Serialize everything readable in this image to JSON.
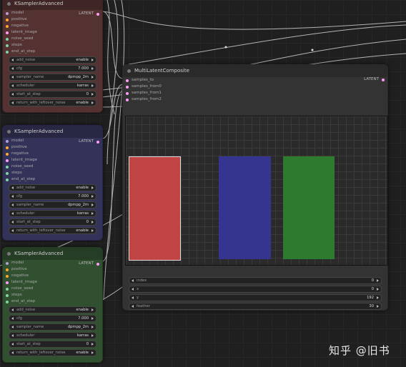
{
  "nodes": {
    "red": {
      "title": "KSamplerAdvanced",
      "inputs": [
        "model",
        "positive",
        "negative",
        "latent_image",
        "noise_seed",
        "steps",
        "end_at_step"
      ],
      "output": "LATENT",
      "widgets": [
        {
          "label": "add_noise",
          "value": "enable"
        },
        {
          "label": "cfg",
          "value": "7.000"
        },
        {
          "label": "sampler_name",
          "value": "dpmpp_2m"
        },
        {
          "label": "scheduler",
          "value": "karras"
        },
        {
          "label": "start_at_step",
          "value": "0"
        },
        {
          "label": "return_with_leftover_noise",
          "value": "enable"
        }
      ]
    },
    "blue": {
      "title": "KSamplerAdvanced",
      "inputs": [
        "model",
        "positive",
        "negative",
        "latent_image",
        "noise_seed",
        "steps",
        "end_at_step"
      ],
      "output": "LATENT",
      "widgets": [
        {
          "label": "add_noise",
          "value": "enable"
        },
        {
          "label": "cfg",
          "value": "7.000"
        },
        {
          "label": "sampler_name",
          "value": "dpmpp_2m"
        },
        {
          "label": "scheduler",
          "value": "karras"
        },
        {
          "label": "start_at_step",
          "value": "0"
        },
        {
          "label": "return_with_leftover_noise",
          "value": "enable"
        }
      ]
    },
    "green": {
      "title": "KSamplerAdvanced",
      "inputs": [
        "model",
        "positive",
        "negative",
        "latent_image",
        "noise_seed",
        "steps",
        "end_at_step"
      ],
      "output": "LATENT",
      "widgets": [
        {
          "label": "add_noise",
          "value": "enable"
        },
        {
          "label": "cfg",
          "value": "7.000"
        },
        {
          "label": "sampler_name",
          "value": "dpmpp_2m"
        },
        {
          "label": "scheduler",
          "value": "karras"
        },
        {
          "label": "start_at_step",
          "value": "0"
        },
        {
          "label": "return_with_leftover_noise",
          "value": "enable"
        }
      ]
    },
    "composite": {
      "title": "MultiLatentComposite",
      "inputs": [
        "samples_to",
        "samples_from0",
        "samples_from1",
        "samples_from2"
      ],
      "output": "LATENT",
      "widgets": [
        {
          "label": "index",
          "value": "0"
        },
        {
          "label": "x",
          "value": "0"
        },
        {
          "label": "y",
          "value": "192"
        },
        {
          "label": "feather",
          "value": "30"
        }
      ]
    }
  },
  "colors": {
    "red_block": "#c04444",
    "blue_block": "#353590",
    "green_block": "#2e7a2e",
    "output_dot": "#ff9cf9"
  },
  "watermark": "知乎 @旧书"
}
